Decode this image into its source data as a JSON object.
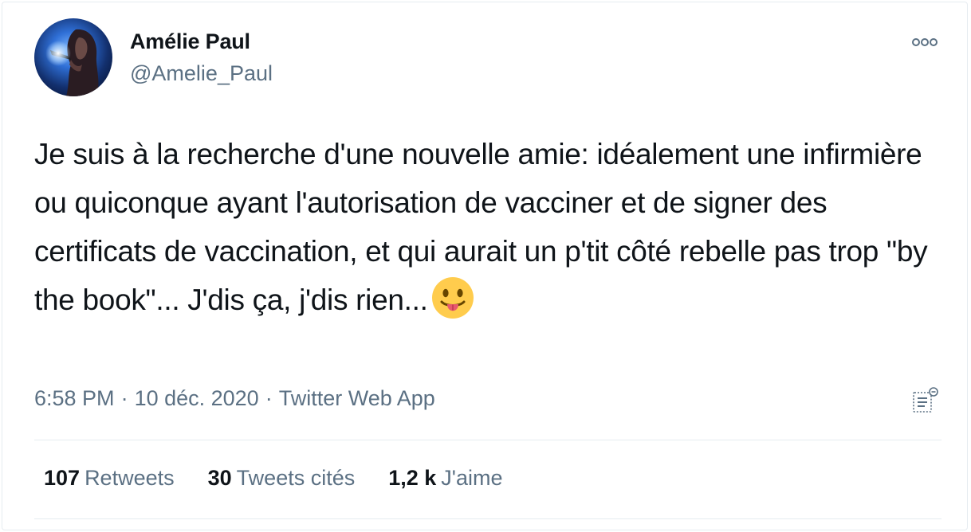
{
  "author": {
    "name": "Amélie Paul",
    "handle": "@Amelie_Paul"
  },
  "tweet": {
    "text": "Je suis à la recherche d'une nouvelle amie: idéalement une infirmière ou quiconque ayant l'autorisation de vacciner et de signer des certificats de vaccination, et qui aurait un p'tit côté rebelle pas trop \"by the book\"... J'dis ça, j'dis rien...",
    "emoji": "face-with-tongue"
  },
  "meta": {
    "time": "6:58 PM",
    "separator": "·",
    "date": "10 déc. 2020",
    "source": "Twitter Web App"
  },
  "stats": {
    "retweets_count": "107",
    "retweets_label": "Retweets",
    "quotes_count": "30",
    "quotes_label": "Tweets cités",
    "likes_count": "1,2 k",
    "likes_label": "J'aime"
  },
  "colors": {
    "text_primary": "#0f1419",
    "text_secondary": "#5b7083",
    "divider": "#e6ecf0"
  },
  "icons": [
    "more-options-icon",
    "analytics-icon",
    "face-with-tongue-emoji"
  ]
}
